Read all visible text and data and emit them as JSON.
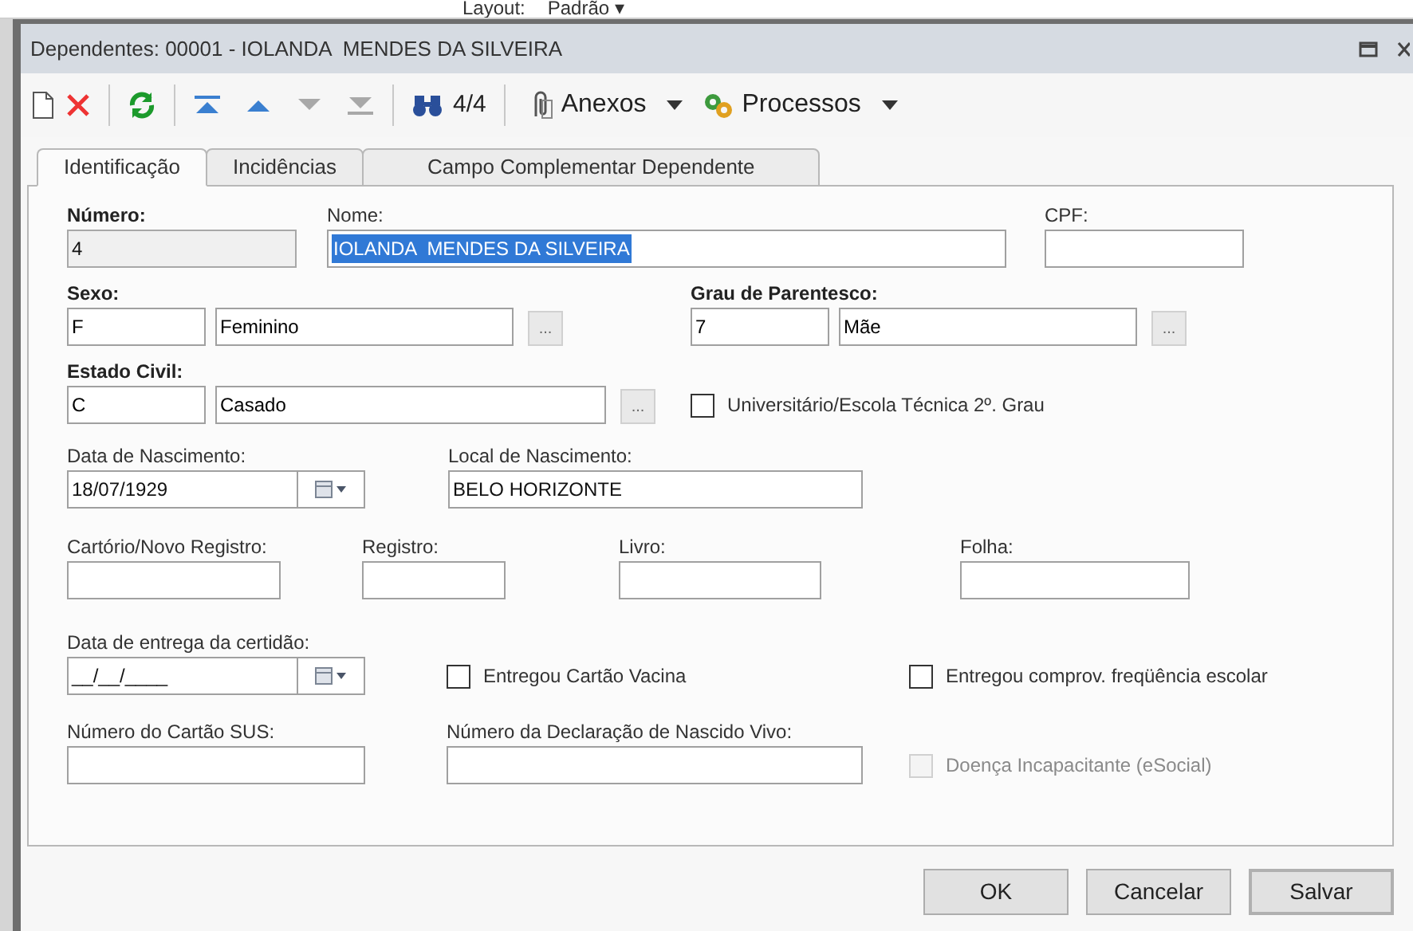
{
  "background": {
    "layout_label": "Layout:",
    "layout_value": "Padrão",
    "layout_caret": "▾"
  },
  "window": {
    "title": "Dependentes: 00001 - IOLANDA  MENDES DA SILVEIRA"
  },
  "toolbar": {
    "record_position": "4/4",
    "menus": [
      {
        "label": "Anexos"
      },
      {
        "label": "Processos"
      }
    ]
  },
  "tabs": [
    {
      "label": "Identificação",
      "selected": true
    },
    {
      "label": "Incidências",
      "selected": false
    },
    {
      "label": "Campo Complementar Dependente",
      "selected": false
    }
  ],
  "form_rows": [
    [
      {
        "kind": "text",
        "label": "Número:",
        "required": true,
        "readonly": true,
        "value": "4",
        "value_selected": false
      },
      {
        "kind": "text",
        "label": "Nome:",
        "required": false,
        "readonly": false,
        "value": "IOLANDA  MENDES DA SILVEIRA",
        "value_selected": true
      },
      {
        "kind": "text",
        "label": "CPF:",
        "required": false,
        "readonly": false
      }
    ],
    [
      {
        "kind": "lookup",
        "label": "Sexo:",
        "required": true,
        "code": "F",
        "description": "Feminino",
        "button_label": "..."
      },
      {
        "kind": "lookup",
        "label": "Grau de Parentesco:",
        "required": true,
        "code": "7",
        "description": "Mãe",
        "button_label": "..."
      }
    ],
    [
      {
        "kind": "lookup",
        "label": "Estado Civil:",
        "required": true,
        "code": "C",
        "description": "Casado",
        "button_label": "..."
      },
      {
        "kind": "checkbox",
        "label": "Universitário/Escola Técnica 2º. Grau",
        "checked": false,
        "disabled": false
      }
    ],
    [
      {
        "kind": "date",
        "label": "Data de Nascimento:",
        "required": false,
        "value": "18/07/1929"
      },
      {
        "kind": "text",
        "label": "Local de Nascimento:",
        "required": false,
        "readonly": false,
        "value": "BELO HORIZONTE",
        "value_selected": false
      }
    ],
    [
      {
        "kind": "text",
        "label": "Cartório/Novo Registro:",
        "required": false,
        "readonly": false
      },
      {
        "kind": "text",
        "label": "Registro:",
        "required": false,
        "readonly": false
      },
      {
        "kind": "text",
        "label": "Livro:",
        "required": false,
        "readonly": false
      },
      {
        "kind": "text",
        "label": "Folha:",
        "required": false,
        "readonly": false
      }
    ],
    [
      {
        "kind": "date",
        "label": "Data de entrega da certidão:",
        "required": false,
        "value": "__/__/____"
      },
      {
        "kind": "checkbox",
        "label": "Entregou Cartão Vacina",
        "checked": false,
        "disabled": false
      },
      {
        "kind": "checkbox",
        "label": "Entregou comprov. freqüência escolar",
        "checked": false,
        "disabled": false
      }
    ],
    [
      {
        "kind": "text",
        "label": "Número do Cartão SUS:",
        "required": false,
        "readonly": false
      },
      {
        "kind": "text",
        "label": "Número da Declaração de Nascido Vivo:",
        "required": false,
        "readonly": false
      },
      {
        "kind": "checkbox",
        "label": "Doença Incapacitante (eSocial)",
        "checked": false,
        "disabled": true
      }
    ]
  ],
  "buttons": [
    {
      "label": "OK",
      "default": false
    },
    {
      "label": "Cancelar",
      "default": false
    },
    {
      "label": "Salvar",
      "default": true
    }
  ]
}
